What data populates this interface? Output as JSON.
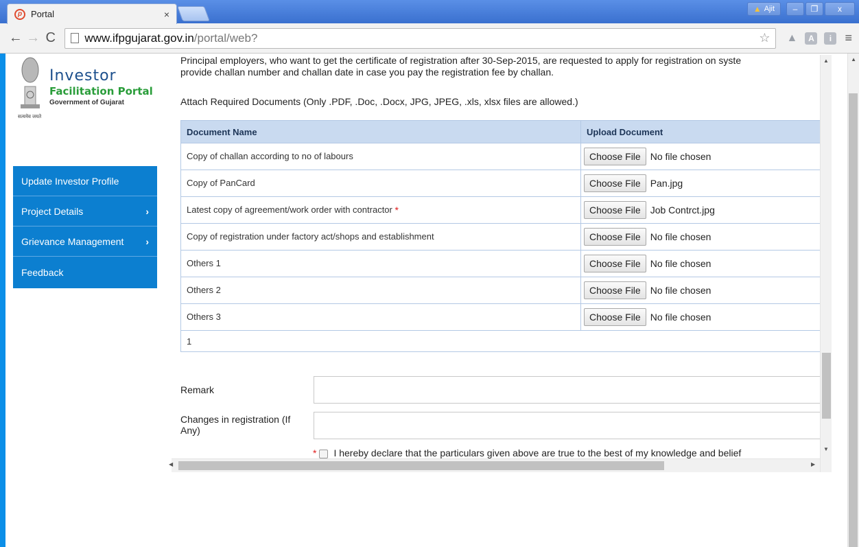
{
  "browser": {
    "tab_title": "Portal",
    "tab_close": "×",
    "user_name": "Ajit",
    "url_host": "www.ifpgujarat.gov.in",
    "url_path": "/portal/web?"
  },
  "logo": {
    "line1": "Investor",
    "line2": "Facilitation Portal",
    "line3": "Government of Gujarat",
    "motto": "सत्यमेव जयते"
  },
  "sidebar": {
    "items": [
      {
        "label": "Update Investor Profile",
        "chevron": ""
      },
      {
        "label": "Project Details",
        "chevron": "›"
      },
      {
        "label": "Grievance Management",
        "chevron": "›"
      },
      {
        "label": "Feedback",
        "chevron": ""
      }
    ]
  },
  "content": {
    "intro_line1": "Principal employers, who want to get the certificate of registration after 30-Sep-2015, are requested to apply for registration on syste",
    "intro_line2": "provide challan number and challan date in case you pay the registration fee by challan.",
    "attach_text": "Attach Required Documents (Only .PDF, .Doc, .Docx, JPG, JPEG, .xls, xlsx files are allowed.)",
    "table": {
      "headers": [
        "Document Name",
        "Upload Document"
      ],
      "button_label": "Choose File",
      "rows": [
        {
          "name": "Copy of challan according to no of labours",
          "required": "",
          "file": "No file chosen"
        },
        {
          "name": "Copy of PanCard",
          "required": "",
          "file": "Pan.jpg"
        },
        {
          "name": "Latest copy of agreement/work order with contractor ",
          "required": "*",
          "file": "Job Contrct.jpg"
        },
        {
          "name": "Copy of registration under factory act/shops and establishment",
          "required": "",
          "file": "No file chosen"
        },
        {
          "name": "Others 1",
          "required": "",
          "file": "No file chosen"
        },
        {
          "name": "Others 2",
          "required": "",
          "file": "No file chosen"
        },
        {
          "name": "Others 3",
          "required": "",
          "file": "No file chosen"
        }
      ],
      "pager": "1"
    },
    "remark_label": "Remark",
    "changes_label_1": "Changes in registration (If",
    "changes_label_2": "Any)",
    "declare_required": "*",
    "declare_text": "I hereby declare that the particulars given above are true to the best of my knowledge and belief"
  },
  "colors": {
    "accent": "#0c7fd0",
    "page_bar": "#0c8fe8",
    "table_header": "#c9daf0"
  }
}
